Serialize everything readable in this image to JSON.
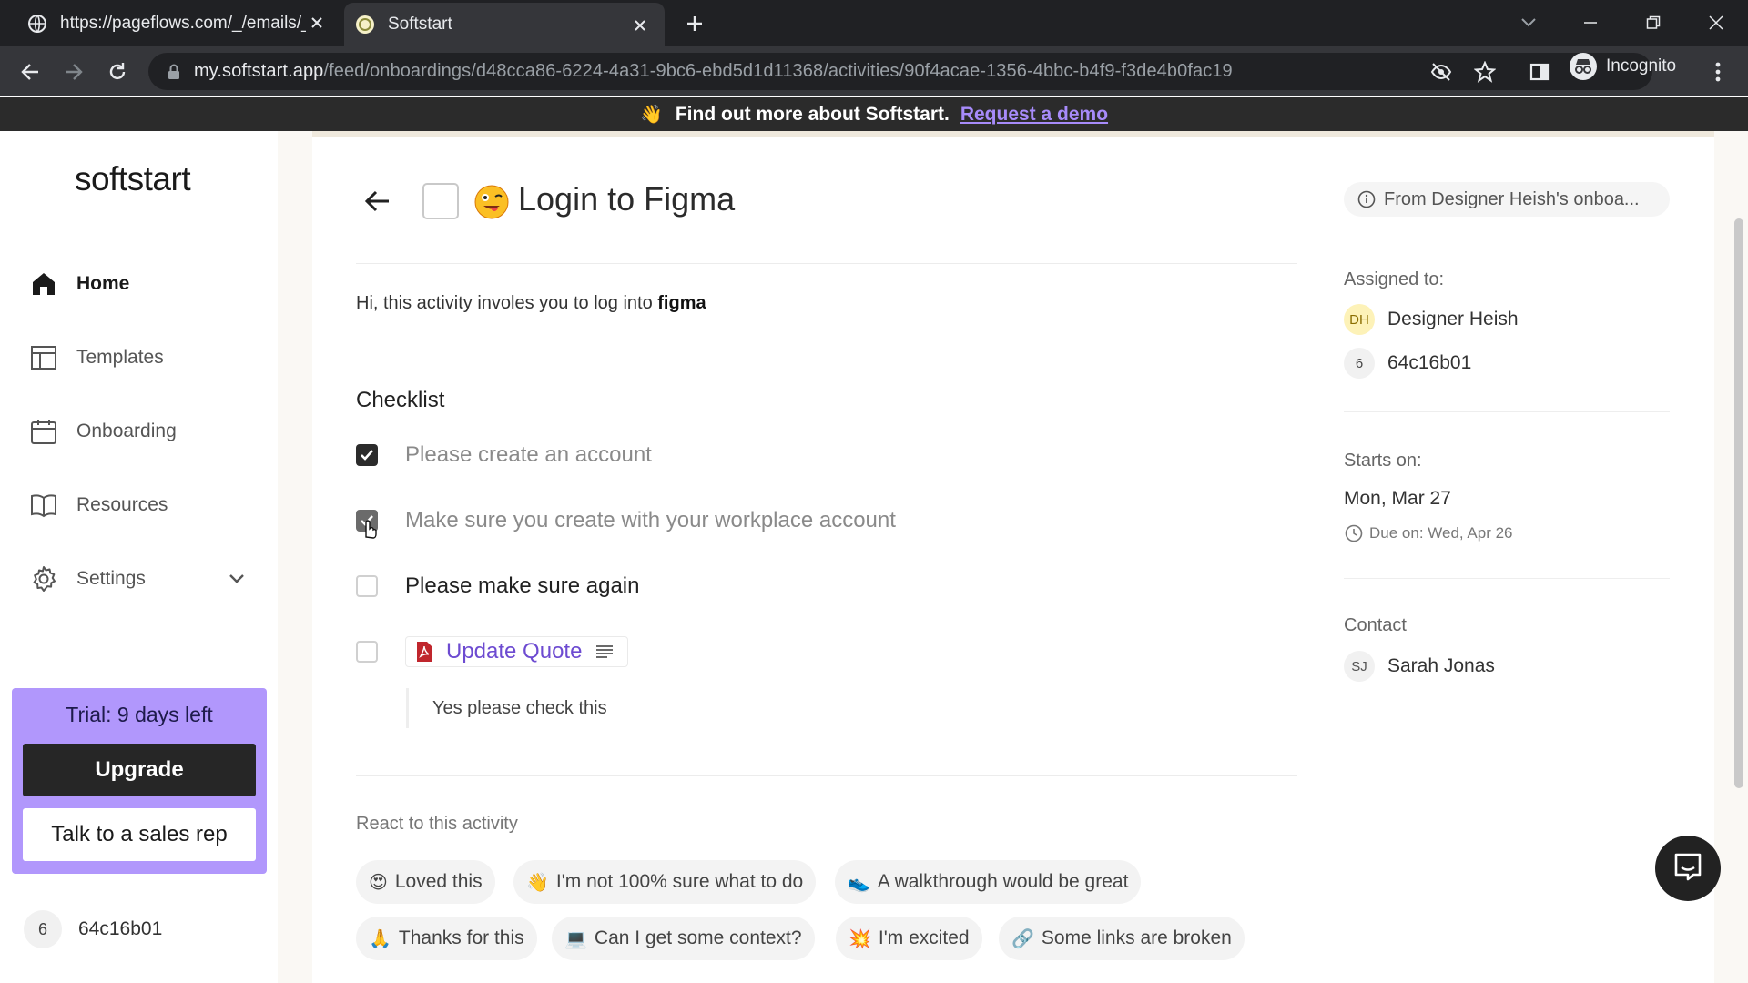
{
  "browser": {
    "tabs": [
      {
        "title": "https://pageflows.com/_/emails/_/",
        "icon": "globe-icon"
      },
      {
        "title": "Softstart",
        "icon": "softstart-favicon"
      }
    ],
    "url_host": "my.softstart.app",
    "url_path": "/feed/onboardings/d48cca86-6224-4a31-9bc6-ebd5d1d11368/activities/90f4acae-1356-4bbc-b4f9-f3de4b0fac19",
    "profile_label": "Incognito"
  },
  "promo": {
    "emoji": "👋",
    "text": "Find out more about Softstart.",
    "link": "Request a demo"
  },
  "sidebar": {
    "logo": "softstart",
    "items": [
      {
        "label": "Home",
        "icon": "home-icon",
        "active": true
      },
      {
        "label": "Templates",
        "icon": "template-icon"
      },
      {
        "label": "Onboarding",
        "icon": "calendar-icon"
      },
      {
        "label": "Resources",
        "icon": "book-icon"
      },
      {
        "label": "Settings",
        "icon": "gear-icon"
      }
    ],
    "trial_text": "Trial: 9 days left",
    "upgrade_label": "Upgrade",
    "sales_label": "Talk to a sales rep",
    "user_badge": "6",
    "user_name": "64c16b01"
  },
  "activity": {
    "title": "Login to Figma",
    "title_emoji": "😜",
    "from_label": "From Designer Heish's onboa...",
    "description_prefix": "Hi, this activity involes you to log into ",
    "description_bold": "figma",
    "checklist_title": "Checklist",
    "checklist": [
      {
        "label": "Please create an account",
        "checked": true
      },
      {
        "label": "Make sure you create with your workplace account",
        "checked": true
      },
      {
        "label": "Please make sure again",
        "checked": false
      }
    ],
    "file_item": {
      "name": "Update Quote",
      "checked": false,
      "note": "Yes please check this"
    },
    "react_title": "React to this activity",
    "reactions": [
      {
        "emoji": "😍",
        "label": "Loved this"
      },
      {
        "emoji": "👋",
        "label": "I'm not 100% sure what to do"
      },
      {
        "emoji": "👟",
        "label": "A walkthrough would be great"
      },
      {
        "emoji": "🙏",
        "label": "Thanks for this"
      },
      {
        "emoji": "💻",
        "label": "Can I get some context?"
      },
      {
        "emoji": "💥",
        "label": "I'm excited"
      },
      {
        "emoji": "🔗",
        "label": "Some links are broken"
      }
    ]
  },
  "meta": {
    "assigned_label": "Assigned to:",
    "assignees": [
      {
        "initials": "DH",
        "name": "Designer Heish"
      },
      {
        "initials": "6",
        "name": "64c16b01"
      }
    ],
    "starts_label": "Starts on:",
    "starts_value": "Mon, Mar 27",
    "due_value": "Due on: Wed, Apr 26",
    "contact_label": "Contact",
    "contact": {
      "initials": "SJ",
      "name": "Sarah Jonas"
    }
  },
  "colors": {
    "accent": "#6d4bd1",
    "trial_bg": "#b197fc",
    "dark": "#262626"
  }
}
